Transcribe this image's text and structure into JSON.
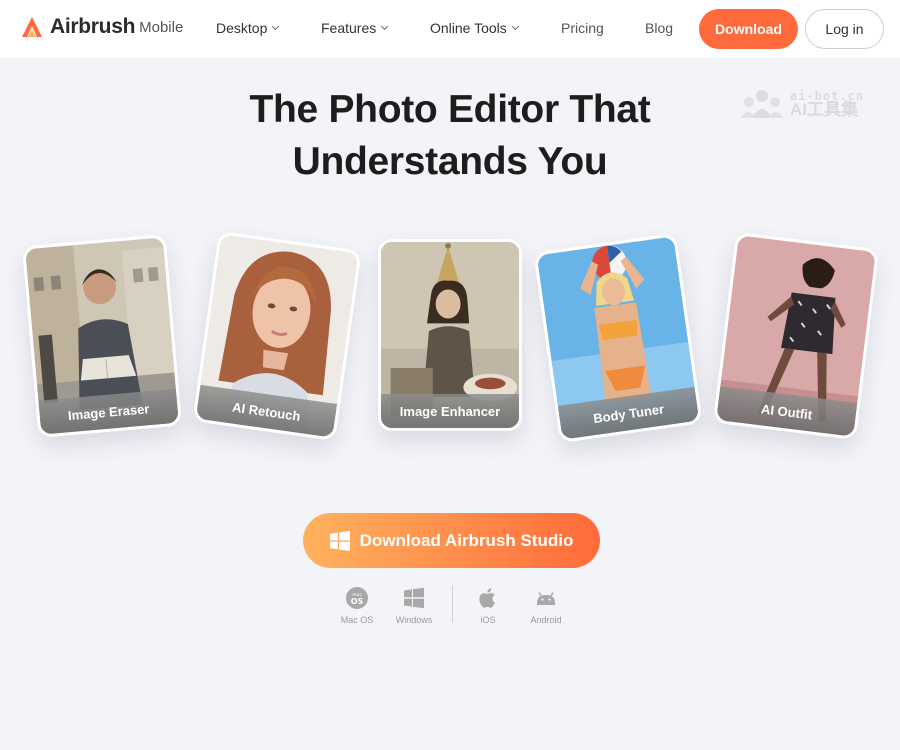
{
  "header": {
    "logo_text": "Airbrush",
    "logo_sub": "Mobile",
    "nav": [
      {
        "label": "Desktop",
        "has_dropdown": true
      },
      {
        "label": "Features",
        "has_dropdown": true
      },
      {
        "label": "Online Tools",
        "has_dropdown": true
      },
      {
        "label": "Pricing",
        "has_dropdown": false
      },
      {
        "label": "Blog",
        "has_dropdown": false
      }
    ],
    "download_label": "Download",
    "login_label": "Log in"
  },
  "hero": {
    "title_line1": "The Photo Editor That",
    "title_line2": "Understands You"
  },
  "watermark": {
    "url": "ai-bot.cn",
    "text": "AI工具集"
  },
  "cards": [
    {
      "label": "Image Eraser"
    },
    {
      "label": "AI Retouch"
    },
    {
      "label": "Image Enhancer"
    },
    {
      "label": "Body Tuner"
    },
    {
      "label": "AI Outfit"
    }
  ],
  "cta": {
    "label": "Download Airbrush Studio",
    "icon": "windows-icon"
  },
  "platforms": [
    {
      "label": "Mac OS",
      "icon": "macos-icon"
    },
    {
      "label": "Windows",
      "icon": "windows-icon"
    },
    {
      "label": "iOS",
      "icon": "apple-icon"
    },
    {
      "label": "Android",
      "icon": "android-icon"
    }
  ],
  "colors": {
    "accent": "#ff6a3d",
    "background": "#f3f4f8",
    "cta_gradient_start": "#ffb25e",
    "cta_gradient_end": "#ff6b3a"
  }
}
